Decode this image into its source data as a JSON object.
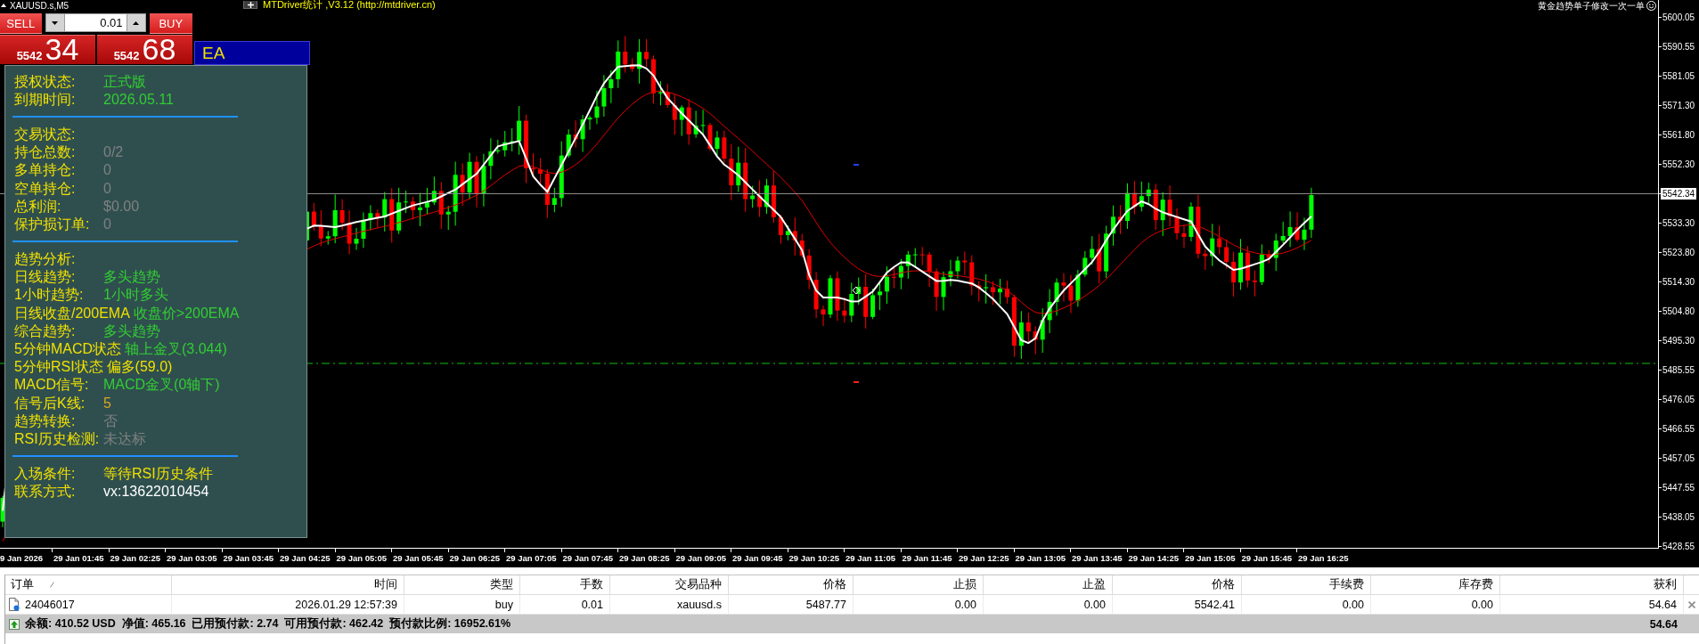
{
  "chart": {
    "symbol_title": "XAUUSD.s,M5",
    "indicator_title": "MTDriver统计 ,V3.12 (http://mtdriver.cn)",
    "comment": "黄金趋势单子修改一次一单",
    "price_axis": [
      {
        "label": "5600.05",
        "kind": "tick"
      },
      {
        "label": "5590.55",
        "kind": "tick"
      },
      {
        "label": "5581.05",
        "kind": "tick"
      },
      {
        "label": "5571.30",
        "kind": "tick"
      },
      {
        "label": "5561.80",
        "kind": "tick"
      },
      {
        "label": "5552.30",
        "kind": "tick"
      },
      {
        "label": "5542.34",
        "kind": "current"
      },
      {
        "label": "5533.30",
        "kind": "tick"
      },
      {
        "label": "5523.80",
        "kind": "tick"
      },
      {
        "label": "5514.30",
        "kind": "tick"
      },
      {
        "label": "5504.80",
        "kind": "tick"
      },
      {
        "label": "5495.30",
        "kind": "tick"
      },
      {
        "label": "5485.55",
        "kind": "tick"
      },
      {
        "label": "5476.05",
        "kind": "tick"
      },
      {
        "label": "5466.55",
        "kind": "tick"
      },
      {
        "label": "5457.05",
        "kind": "tick"
      },
      {
        "label": "5447.55",
        "kind": "tick"
      },
      {
        "label": "5438.05",
        "kind": "tick"
      },
      {
        "label": "5428.55",
        "kind": "tick"
      }
    ],
    "time_axis": [
      "9 Jan 2026",
      "29 Jan 01:45",
      "29 Jan 02:25",
      "29 Jan 03:05",
      "29 Jan 03:45",
      "29 Jan 04:25",
      "29 Jan 05:05",
      "29 Jan 05:45",
      "29 Jan 06:25",
      "29 Jan 07:05",
      "29 Jan 07:45",
      "29 Jan 08:25",
      "29 Jan 09:05",
      "29 Jan 09:45",
      "29 Jan 10:25",
      "29 Jan 11:05",
      "29 Jan 11:45",
      "29 Jan 12:25",
      "29 Jan 13:05",
      "29 Jan 13:45",
      "29 Jan 14:25",
      "29 Jan 15:05",
      "29 Jan 15:45",
      "29 Jan 16:25"
    ]
  },
  "trade_panel": {
    "sell_label": "SELL",
    "buy_label": "BUY",
    "lot": "0.01",
    "sell_price": {
      "prefix": "5542",
      "pips": "34"
    },
    "buy_price": {
      "prefix": "5542",
      "pips": "68"
    }
  },
  "ea_panel": {
    "title": "EA",
    "sections": [
      {
        "rows": [
          {
            "label": "授权状态:",
            "value": "正式版",
            "color": "#32cd32"
          },
          {
            "label": "到期时间:",
            "value": "2026.05.11",
            "color": "#32cd32"
          }
        ]
      },
      {
        "heading": "交易状态:",
        "rows": [
          {
            "label": "持仓总数:",
            "value": "0/2",
            "color": "#808080"
          },
          {
            "label": "多单持仓:",
            "value": "0",
            "color": "#808080"
          },
          {
            "label": "空单持仓:",
            "value": "0",
            "color": "#808080"
          },
          {
            "label": "总利润:",
            "value": "$0.00",
            "color": "#808080"
          },
          {
            "label": "保护损订单:",
            "value": "0",
            "color": "#808080"
          }
        ]
      },
      {
        "heading": "趋势分析:",
        "rows": [
          {
            "label": "日线趋势:",
            "value": "多头趋势",
            "color": "#32cd32"
          },
          {
            "label": "1小时趋势:",
            "value": "1小时多头",
            "color": "#32cd32"
          },
          {
            "label": "日线收盘/200EMA",
            "value": "收盘价>200EMA",
            "color": "#32cd32"
          },
          {
            "label": "综合趋势:",
            "value": "多头趋势",
            "color": "#32cd32"
          },
          {
            "label": "5分钟MACD状态",
            "value": "轴上金叉(3.044)",
            "color": "#32cd32"
          },
          {
            "label": "5分钟RSI状态",
            "value": "偏多(59.0)",
            "color": "#f0e000"
          },
          {
            "label": "MACD信号:",
            "value": "MACD金叉(0轴下)",
            "color": "#32cd32"
          },
          {
            "label": "信号后K线:",
            "value": "5",
            "color": "#daa520"
          },
          {
            "label": "趋势转换:",
            "value": "否",
            "color": "#808080"
          },
          {
            "label": "RSI历史检测:",
            "value": "未达标",
            "color": "#808080"
          }
        ]
      },
      {
        "rows": [
          {
            "label": "入场条件:",
            "value": "等待RSI历史条件",
            "color": "#f0e000"
          },
          {
            "label": "联系方式:",
            "value": "vx:13622010454",
            "color": "#ffffff"
          }
        ]
      }
    ]
  },
  "terminal": {
    "columns": [
      {
        "label": "订单",
        "sorted": true
      },
      {
        "label": "时间",
        "sorted": false
      },
      {
        "label": "类型",
        "sorted": false
      },
      {
        "label": "手数",
        "sorted": false
      },
      {
        "label": "交易品种",
        "sorted": false
      },
      {
        "label": "价格",
        "sorted": false
      },
      {
        "label": "止损",
        "sorted": false
      },
      {
        "label": "止盈",
        "sorted": false
      },
      {
        "label": "价格",
        "sorted": false
      },
      {
        "label": "手续费",
        "sorted": false
      },
      {
        "label": "库存费",
        "sorted": false
      },
      {
        "label": "获利",
        "sorted": false
      }
    ],
    "rows": [
      {
        "cells": [
          "24046017",
          "2026.01.29 12:57:39",
          "buy",
          "0.01",
          "xauusd.s",
          "5487.77",
          "0.00",
          "0.00",
          "5542.41",
          "0.00",
          "0.00",
          "54.64"
        ]
      }
    ],
    "summary": {
      "text": "余额: 410.52 USD  净值: 465.16  已用预付款: 2.74  可用预付款: 462.42  预付款比例: 16952.61%",
      "profit": "54.64"
    }
  }
}
